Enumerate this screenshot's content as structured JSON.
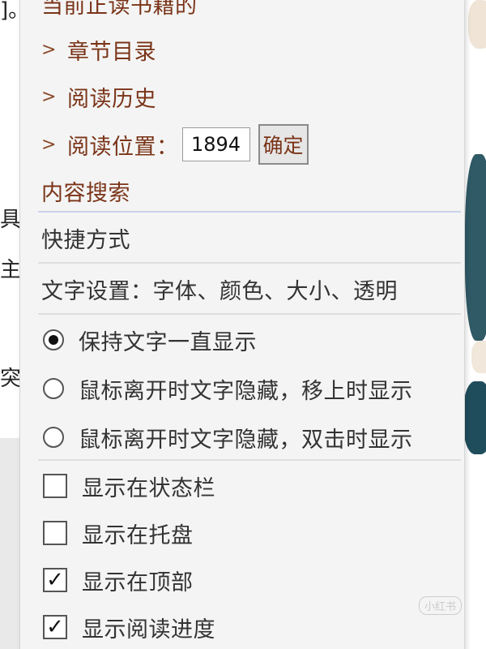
{
  "background": {
    "fragments": [
      "]。",
      "具",
      "主:",
      "突"
    ]
  },
  "menu": {
    "header_partial": "当前正读书籍的",
    "nav_items": [
      {
        "label": "章节目录"
      },
      {
        "label": "阅读历史"
      }
    ],
    "position": {
      "label": "阅读位置：",
      "value": "1894",
      "confirm_label": "确定"
    },
    "search_label": "内容搜索",
    "shortcut_label": "快捷方式",
    "text_settings_label": "文字设置：字体、颜色、大小、透明",
    "display_modes": [
      {
        "label": "保持文字一直显示",
        "selected": true
      },
      {
        "label": "鼠标离开时文字隐藏，移上时显示",
        "selected": false
      },
      {
        "label": "鼠标离开时文字隐藏，双击时显示",
        "selected": false
      }
    ],
    "options": [
      {
        "label": "显示在状态栏",
        "checked": false
      },
      {
        "label": "显示在托盘",
        "checked": false
      },
      {
        "label": "显示在顶部",
        "checked": true
      },
      {
        "label": "显示阅读进度",
        "checked": true
      }
    ]
  },
  "icons": {
    "chevron": "chevron-right-icon",
    "check": "checkmark-icon"
  },
  "colors": {
    "accent_brown": "#7a3418",
    "menu_bg": "#f4f4f4",
    "separator_blue": "#c9d3ea"
  },
  "watermark": {
    "badge": "小红书"
  }
}
